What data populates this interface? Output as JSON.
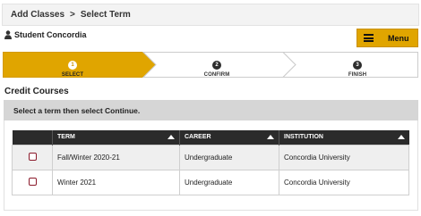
{
  "breadcrumb": {
    "items": [
      "Add Classes",
      "Select Term"
    ],
    "separator": ">"
  },
  "user": {
    "name": "Student Concordia",
    "icon": "person-icon"
  },
  "menu": {
    "label": "Menu",
    "icon": "hamburger-icon",
    "color": "#e0a500"
  },
  "steps": [
    {
      "number": "1",
      "label": "SELECT",
      "state": "active"
    },
    {
      "number": "2",
      "label": "CONFIRM",
      "state": "todo"
    },
    {
      "number": "3",
      "label": "FINISH",
      "state": "todo"
    }
  ],
  "section": {
    "title": "Credit Courses"
  },
  "instructions": "Select a term then select Continue.",
  "table": {
    "headers": [
      "TERM",
      "CAREER",
      "INSTITUTION"
    ],
    "rows": [
      {
        "term": "Fall/Winter 2020-21",
        "career": "Undergraduate",
        "institution": "Concordia University"
      },
      {
        "term": "Winter 2021",
        "career": "Undergraduate",
        "institution": "Concordia University"
      }
    ]
  },
  "colors": {
    "accent": "#e0a500",
    "header_bg": "#2b2b2b",
    "checkbox_border": "#8b1a2b"
  }
}
